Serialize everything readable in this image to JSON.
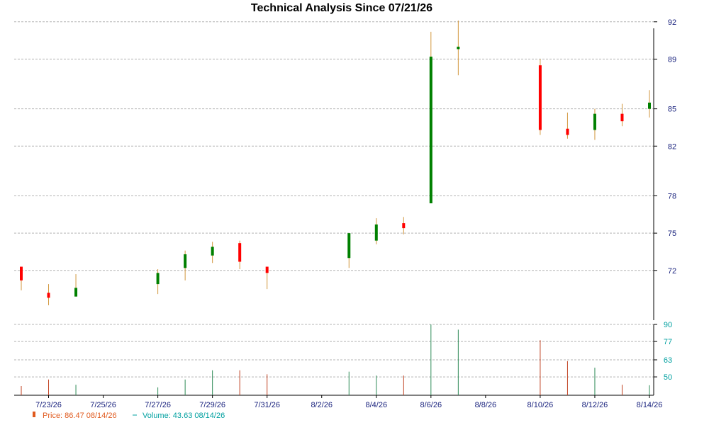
{
  "chart_data": {
    "type": "candlestick",
    "title": "Technical Analysis Since 07/21/26",
    "price_axis": {
      "ylim": [
        68,
        92.5
      ],
      "ticks": [
        "72",
        "75",
        "78",
        "82",
        "85",
        "89",
        "92"
      ]
    },
    "volume_axis": {
      "ylim": [
        36,
        90
      ],
      "ticks": [
        "50",
        "63",
        "77",
        "90"
      ]
    },
    "x_axis": {
      "ticks": [
        "7/23/26",
        "7/25/26",
        "7/27/26",
        "7/29/26",
        "7/31/26",
        "8/2/26",
        "8/4/26",
        "8/6/26",
        "8/8/26",
        "8/10/26",
        "8/12/26",
        "8/14/26"
      ]
    },
    "grid": true,
    "candles": [
      {
        "date": "7/22/26",
        "open": 72.3,
        "close": 71.2,
        "high": 72.3,
        "low": 70.4,
        "volume": 43
      },
      {
        "date": "7/23/26",
        "open": 70.2,
        "close": 69.8,
        "high": 70.9,
        "low": 69.2,
        "volume": 48
      },
      {
        "date": "7/24/26",
        "open": 69.9,
        "close": 70.6,
        "high": 71.7,
        "low": 69.9,
        "volume": 44
      },
      {
        "date": "7/27/26",
        "open": 70.9,
        "close": 71.8,
        "high": 72.1,
        "low": 70.1,
        "volume": 42
      },
      {
        "date": "7/28/26",
        "open": 72.2,
        "close": 73.3,
        "high": 73.6,
        "low": 71.2,
        "volume": 48
      },
      {
        "date": "7/29/26",
        "open": 73.2,
        "close": 73.9,
        "high": 74.3,
        "low": 72.6,
        "volume": 55
      },
      {
        "date": "7/30/26",
        "open": 74.2,
        "close": 72.7,
        "high": 74.4,
        "low": 72.1,
        "volume": 55
      },
      {
        "date": "7/31/26",
        "open": 72.3,
        "close": 71.8,
        "high": 72.3,
        "low": 70.5,
        "volume": 52
      },
      {
        "date": "8/3/26",
        "open": 73.0,
        "close": 75.0,
        "high": 75.0,
        "low": 72.2,
        "volume": 54
      },
      {
        "date": "8/4/26",
        "open": 74.4,
        "close": 75.7,
        "high": 76.2,
        "low": 74.1,
        "volume": 51
      },
      {
        "date": "8/5/26",
        "open": 75.8,
        "close": 75.4,
        "high": 76.3,
        "low": 74.9,
        "volume": 51
      },
      {
        "date": "8/6/26",
        "open": 77.4,
        "close": 89.2,
        "high": 91.2,
        "low": 77.4,
        "volume": 90
      },
      {
        "date": "8/7/26",
        "open": 89.8,
        "close": 90.0,
        "high": 92.1,
        "low": 87.7,
        "volume": 86
      },
      {
        "date": "8/10/26",
        "open": 88.5,
        "close": 83.3,
        "high": 89.0,
        "low": 82.9,
        "volume": 78
      },
      {
        "date": "8/11/26",
        "open": 83.4,
        "close": 82.9,
        "high": 84.7,
        "low": 82.6,
        "volume": 62
      },
      {
        "date": "8/12/26",
        "open": 83.3,
        "close": 84.6,
        "high": 85.0,
        "low": 82.5,
        "volume": 57
      },
      {
        "date": "8/13/26",
        "open": 84.6,
        "close": 84.0,
        "high": 85.4,
        "low": 83.6,
        "volume": 44
      },
      {
        "date": "8/14/26",
        "open": 85.0,
        "close": 85.5,
        "high": 86.5,
        "low": 84.3,
        "volume": 43.63
      }
    ],
    "legend": {
      "price_label": "Price: 86.47 08/14/26",
      "volume_label": "Volume: 43.63 08/14/26"
    },
    "colors": {
      "up": "#008000",
      "down": "#ff0000",
      "wick": "#d2963c",
      "vol_up": "#2e8b57",
      "vol_down": "#c04020",
      "price_axis_text": "#1a237e",
      "volume_axis_text": "#00a0a0",
      "legend_price": "#e05a1e",
      "legend_volume": "#00a0a0",
      "grid": "#b4b4b4"
    }
  }
}
